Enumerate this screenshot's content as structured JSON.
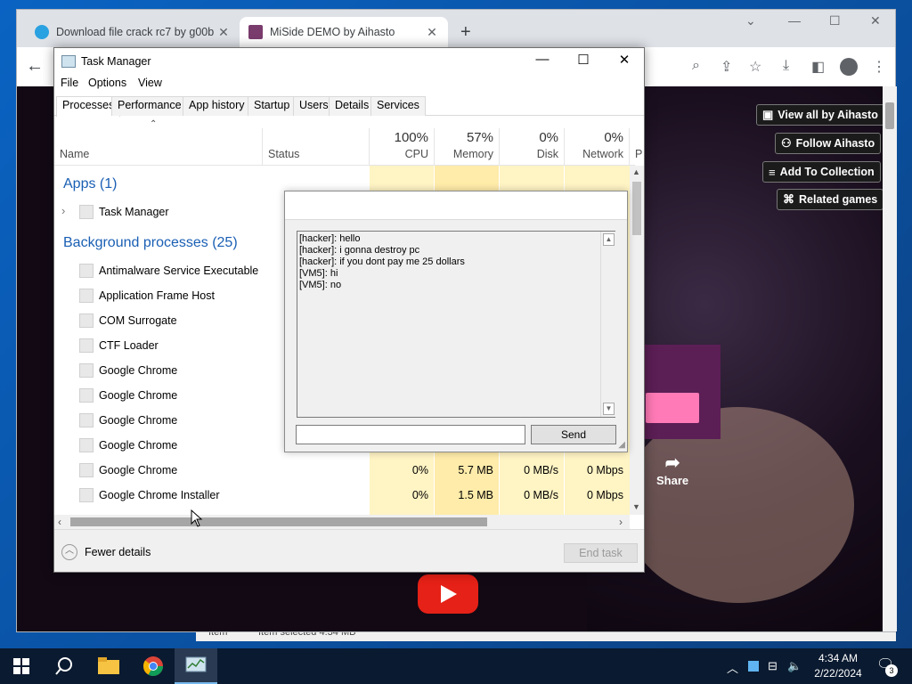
{
  "chrome": {
    "tabs": [
      {
        "title": "Download file crack rc7 by g00b",
        "active": false
      },
      {
        "title": "MiSide DEMO by Aihasto",
        "active": true
      }
    ],
    "itch_buttons": [
      "View all by Aihasto",
      "Follow Aihasto",
      "Add To Collection",
      "Related games"
    ],
    "share_label": "Share"
  },
  "explorer_peek": {
    "left": "Item",
    "right": "Item selected  4.34 MB"
  },
  "task_manager": {
    "title": "Task Manager",
    "menu": [
      "File",
      "Options",
      "View"
    ],
    "tabs": [
      "Processes",
      "Performance",
      "App history",
      "Startup",
      "Users",
      "Details",
      "Services"
    ],
    "columns": {
      "name": "Name",
      "status": "Status",
      "cpu_pct": "100%",
      "cpu": "CPU",
      "mem_pct": "57%",
      "mem": "Memory",
      "disk_pct": "0%",
      "disk": "Disk",
      "net_pct": "0%",
      "net": "Network",
      "power": "P"
    },
    "apps_header": "Apps (1)",
    "apps": [
      {
        "name": "Task Manager"
      }
    ],
    "bg_header": "Background processes (25)",
    "processes": [
      {
        "name": "Antimalware Service Executable",
        "cpu": "",
        "mem": "",
        "disk": "",
        "net": ""
      },
      {
        "name": "Application Frame Host",
        "cpu": "",
        "mem": "",
        "disk": "",
        "net": ""
      },
      {
        "name": "COM Surrogate",
        "cpu": "",
        "mem": "",
        "disk": "",
        "net": ""
      },
      {
        "name": "CTF Loader",
        "cpu": "",
        "mem": "",
        "disk": "",
        "net": ""
      },
      {
        "name": "Google Chrome",
        "cpu": "",
        "mem": "",
        "disk": "",
        "net": ""
      },
      {
        "name": "Google Chrome",
        "cpu": "",
        "mem": "",
        "disk": "",
        "net": ""
      },
      {
        "name": "Google Chrome",
        "cpu": "",
        "mem": "",
        "disk": "",
        "net": ""
      },
      {
        "name": "Google Chrome",
        "cpu": "",
        "mem": "",
        "disk": "",
        "net": ""
      },
      {
        "name": "Google Chrome",
        "cpu": "0%",
        "mem": "5.7 MB",
        "disk": "0 MB/s",
        "net": "0 Mbps"
      },
      {
        "name": "Google Chrome Installer",
        "cpu": "0%",
        "mem": "1.5 MB",
        "disk": "0 MB/s",
        "net": "0 Mbps"
      }
    ],
    "fewer_details": "Fewer details",
    "end_task": "End task"
  },
  "chat": {
    "lines": [
      "[hacker]: hello",
      "[hacker]: i gonna destroy pc",
      "[hacker]: if you dont pay me 25 dollars",
      "[VM5]: hi",
      "[VM5]: no"
    ],
    "input_value": "",
    "send_label": "Send"
  },
  "taskbar": {
    "time": "4:34 AM",
    "date": "2/22/2024",
    "notification_count": "3"
  }
}
